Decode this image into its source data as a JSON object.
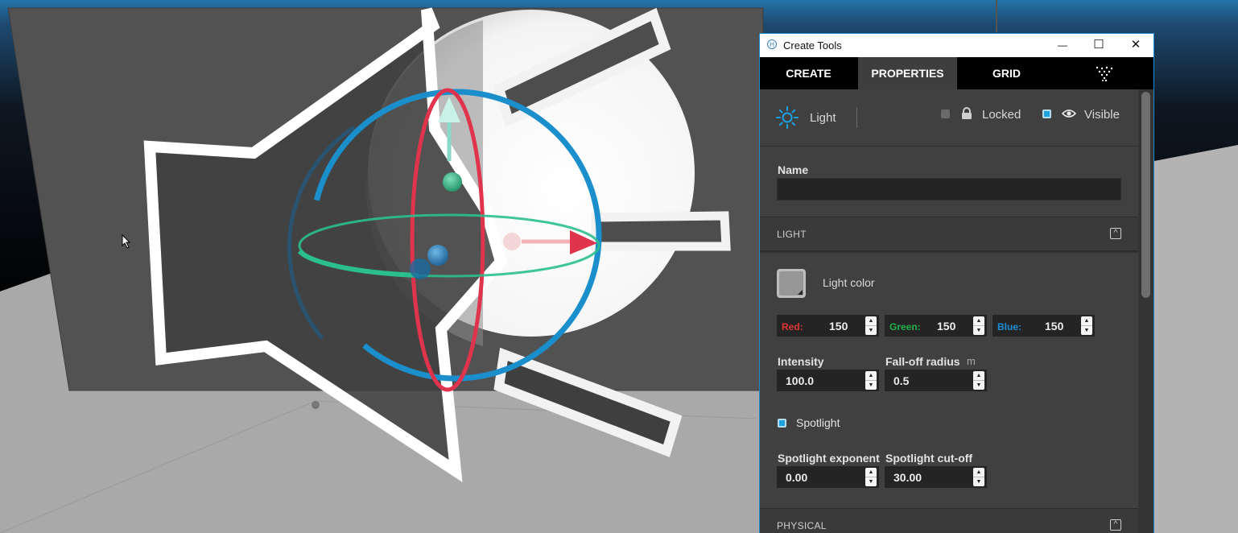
{
  "window": {
    "title": "Create Tools",
    "controls": {
      "minimize": "—",
      "maximize": "☐",
      "close": "✕"
    }
  },
  "tabs": [
    {
      "label": "CREATE",
      "active": false
    },
    {
      "label": "PROPERTIES",
      "active": true
    },
    {
      "label": "GRID",
      "active": false
    }
  ],
  "entity": {
    "type_label": "Light",
    "locked": {
      "label": "Locked",
      "checked": false
    },
    "visible": {
      "label": "Visible",
      "checked": true
    }
  },
  "name_field": {
    "label": "Name",
    "value": ""
  },
  "light_section": {
    "title": "LIGHT",
    "color_label": "Light color",
    "swatch_color": "#969696",
    "red": {
      "label": "Red:",
      "value": "150",
      "color": "#e03535"
    },
    "green": {
      "label": "Green:",
      "value": "150",
      "color": "#22b14c"
    },
    "blue": {
      "label": "Blue:",
      "value": "150",
      "color": "#1e8ed6"
    },
    "intensity": {
      "label": "Intensity",
      "value": "100.0"
    },
    "falloff": {
      "label": "Fall-off radius",
      "unit": "m",
      "value": "0.5"
    },
    "spotlight": {
      "label": "Spotlight",
      "checked": true
    },
    "spot_exponent": {
      "label": "Spotlight exponent",
      "value": "0.00"
    },
    "spot_cutoff": {
      "label": "Spotlight cut-off",
      "value": "30.00"
    }
  },
  "physical_section": {
    "title": "PHYSICAL"
  },
  "icons": {
    "light": "sun-icon",
    "lock": "lock-icon",
    "eye": "eye-icon",
    "particles": "particles-icon",
    "cursor": "mouse-cursor-icon"
  },
  "colors": {
    "accent": "#1e8bd0",
    "gizmo_red": "#e0344d",
    "gizmo_green": "#2bbf8d",
    "gizmo_blue": "#1a8fcc"
  }
}
